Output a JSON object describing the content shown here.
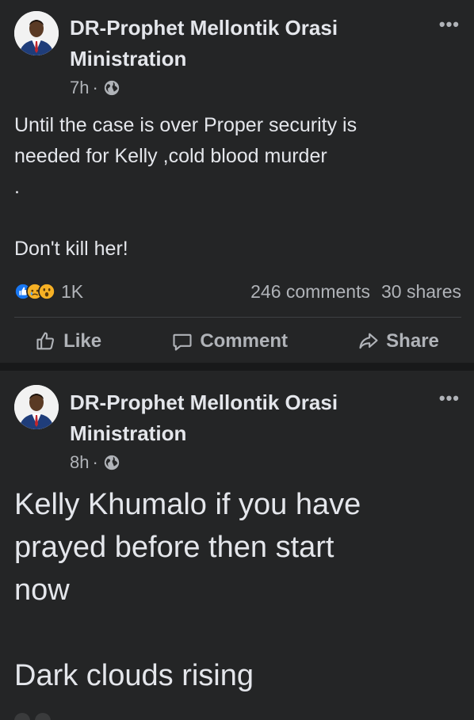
{
  "posts": [
    {
      "author": "DR-Prophet Mellontik Orasi Ministration",
      "time": "7h",
      "separator": "·",
      "more_label": "•••",
      "body_lines": [
        "Until the case is over Proper security is",
        "needed for Kelly ,cold blood murder",
        ".",
        "",
        "Don't kill her!"
      ],
      "reactions": [
        "like-reaction-icon",
        "sad-reaction-icon",
        "wow-reaction-icon"
      ],
      "reaction_count": "1K",
      "comments": "246 comments",
      "shares": "30 shares",
      "actions": {
        "like": "Like",
        "comment": "Comment",
        "share": "Share"
      }
    },
    {
      "author": "DR-Prophet Mellontik Orasi Ministration",
      "time": "8h",
      "separator": "·",
      "more_label": "•••",
      "body_lines": [
        "Kelly Khumalo if you have",
        "prayed before then start",
        "now",
        "",
        "Dark clouds rising"
      ]
    }
  ],
  "colors": {
    "background": "#18191a",
    "card": "#242526",
    "text_primary": "#e4e6eb",
    "text_secondary": "#b0b3b8",
    "like_blue": "#1877f2"
  }
}
